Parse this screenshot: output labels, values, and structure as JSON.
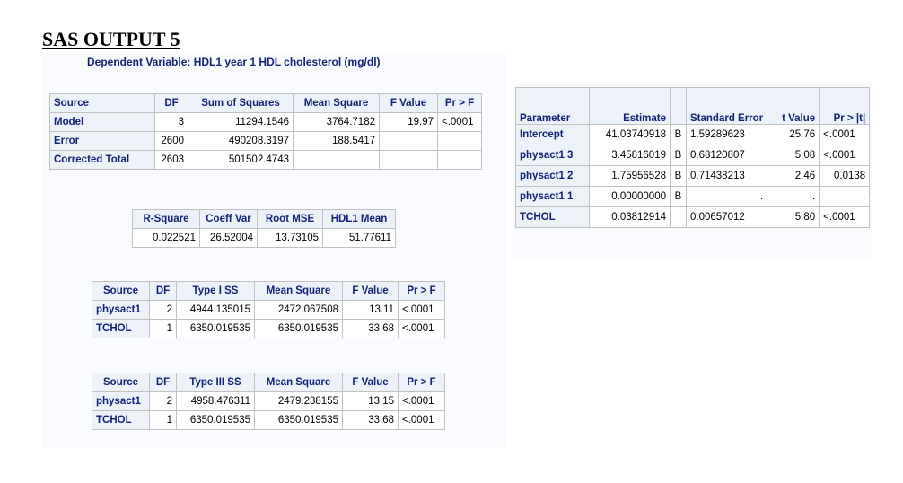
{
  "heading": "SAS OUTPUT 5",
  "caption": "Dependent Variable: HDL1 year 1 HDL cholesterol (mg/dl)",
  "anova": {
    "headers": [
      "Source",
      "DF",
      "Sum of Squares",
      "Mean Square",
      "F Value",
      "Pr > F"
    ],
    "rows": [
      [
        "Model",
        "3",
        "11294.1546",
        "3764.7182",
        "19.97",
        "<.0001"
      ],
      [
        "Error",
        "2600",
        "490208.3197",
        "188.5417",
        "",
        ""
      ],
      [
        "Corrected Total",
        "2603",
        "501502.4743",
        "",
        "",
        ""
      ]
    ]
  },
  "fit": {
    "headers": [
      "R-Square",
      "Coeff Var",
      "Root MSE",
      "HDL1 Mean"
    ],
    "values": [
      "0.022521",
      "26.52004",
      "13.73105",
      "51.77611"
    ]
  },
  "type1": {
    "headers": [
      "Source",
      "DF",
      "Type I SS",
      "Mean Square",
      "F Value",
      "Pr > F"
    ],
    "rows": [
      [
        "physact1",
        "2",
        "4944.135015",
        "2472.067508",
        "13.11",
        "<.0001"
      ],
      [
        "TCHOL",
        "1",
        "6350.019535",
        "6350.019535",
        "33.68",
        "<.0001"
      ]
    ]
  },
  "type3": {
    "headers": [
      "Source",
      "DF",
      "Type III SS",
      "Mean Square",
      "F Value",
      "Pr > F"
    ],
    "rows": [
      [
        "physact1",
        "2",
        "4958.476311",
        "2479.238155",
        "13.15",
        "<.0001"
      ],
      [
        "TCHOL",
        "1",
        "6350.019535",
        "6350.019535",
        "33.68",
        "<.0001"
      ]
    ]
  },
  "params": {
    "headers": [
      "Parameter",
      "Estimate",
      "",
      "Standard Error",
      "t Value",
      "Pr > |t|"
    ],
    "rows": [
      [
        "Intercept",
        "41.03740918",
        "B",
        "1.59289623",
        "25.76",
        "<.0001"
      ],
      [
        "physact1 3",
        "3.45816019",
        "B",
        "0.68120807",
        "5.08",
        "<.0001"
      ],
      [
        "physact1 2",
        "1.75956528",
        "B",
        "0.71438213",
        "2.46",
        "0.0138"
      ],
      [
        "physact1 1",
        "0.00000000",
        "B",
        ".",
        ".",
        "."
      ],
      [
        "TCHOL",
        "0.03812914",
        "",
        "0.00657012",
        "5.80",
        "<.0001"
      ]
    ]
  }
}
